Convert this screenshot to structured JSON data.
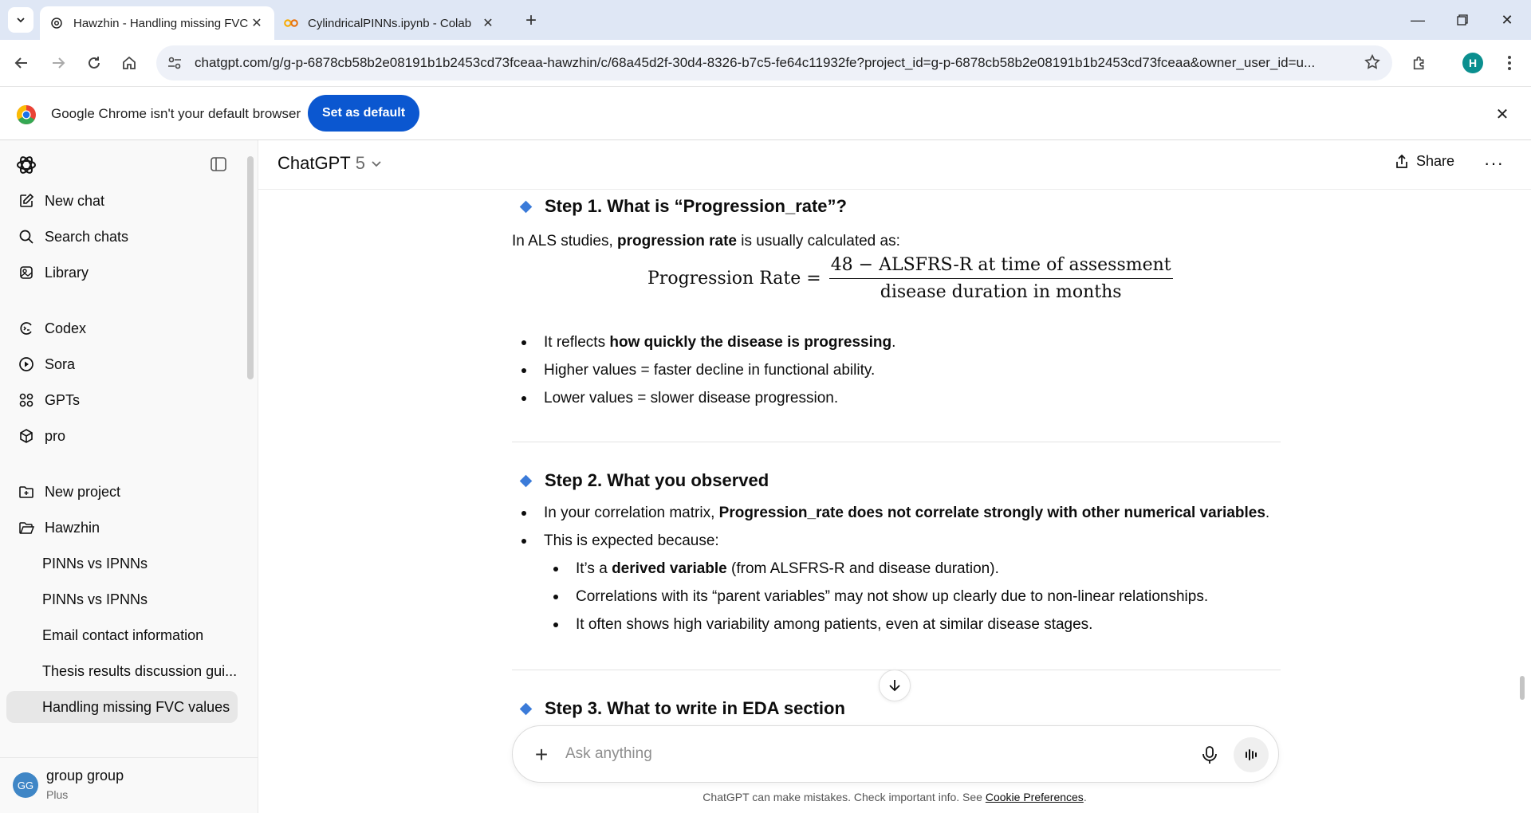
{
  "browser": {
    "tabs": [
      {
        "title": "Hawzhin - Handling missing FVC",
        "active": true,
        "icon": "chatgpt-icon"
      },
      {
        "title": "CylindricalPINNs.ipynb - Colab",
        "active": false,
        "icon": "colab-icon"
      }
    ],
    "url": "chatgpt.com/g/g-p-6878cb58b2e08191b1b2453cd73fceaa-hawzhin/c/68a45d2f-30d4-8326-b7c5-fe64c11932fe?project_id=g-p-6878cb58b2e08191b1b2453cd73fceaa&owner_user_id=u...",
    "profile_initial": "H",
    "infobar": {
      "message": "Google Chrome isn't your default browser",
      "button": "Set as default"
    }
  },
  "sidebar": {
    "top_items": [
      {
        "label": "New chat",
        "icon": "edit-icon"
      },
      {
        "label": "Search chats",
        "icon": "search-icon"
      },
      {
        "label": "Library",
        "icon": "library-icon"
      }
    ],
    "app_items": [
      {
        "label": "Codex",
        "icon": "codex-icon"
      },
      {
        "label": "Sora",
        "icon": "sora-icon"
      },
      {
        "label": "GPTs",
        "icon": "gpts-icon"
      },
      {
        "label": "pro",
        "icon": "cube-icon"
      }
    ],
    "project_items": [
      {
        "label": "New project",
        "icon": "new-folder-icon"
      },
      {
        "label": "Hawzhin",
        "icon": "folder-icon"
      }
    ],
    "chats": [
      {
        "label": "PINNs vs IPNNs",
        "selected": false
      },
      {
        "label": "PINNs vs IPNNs",
        "selected": false
      },
      {
        "label": "Email contact information",
        "selected": false
      },
      {
        "label": "Thesis results discussion gui...",
        "selected": false
      },
      {
        "label": "Handling missing FVC values",
        "selected": true
      }
    ],
    "user": {
      "initials": "GG",
      "name": "group group",
      "plan": "Plus"
    }
  },
  "header": {
    "model": "ChatGPT",
    "version": "5",
    "share": "Share"
  },
  "article": {
    "step1": {
      "title": "Step 1. What is “Progression_rate”?",
      "intro_pre": "In ALS studies, ",
      "intro_bold": "progression rate",
      "intro_post": " is usually calculated as:",
      "formula": {
        "lhs": "Progression Rate =",
        "numerator": "48 − ALSFRS-R at time of assessment",
        "denominator": "disease duration in months"
      },
      "b1_pre": "It reflects ",
      "b1_bold": "how quickly the disease is progressing",
      "b1_post": ".",
      "b2": "Higher values = faster decline in functional ability.",
      "b3": "Lower values = slower disease progression."
    },
    "step2": {
      "title": "Step 2. What you observed",
      "b1_pre": "In your correlation matrix, ",
      "b1_bold": "Progression_rate does not correlate strongly with other numerical variables",
      "b1_post": ".",
      "b2": "This is expected because:",
      "s1_pre": "It’s a ",
      "s1_bold": "derived variable",
      "s1_post": " (from ALSFRS-R and disease duration).",
      "s2": "Correlations with its “parent variables” may not show up clearly due to non-linear relationships.",
      "s3": "It often shows high variability among patients, even at similar disease stages."
    },
    "step3": {
      "title": "Step 3. What to write in EDA section"
    }
  },
  "composer": {
    "placeholder": "Ask anything"
  },
  "footer": {
    "text": "ChatGPT can make mistakes. Check important info. See ",
    "link": "Cookie Preferences",
    "end": "."
  },
  "colors": {
    "accent_blue": "#0b57d0",
    "bullet_diamond": "#3b7bd9",
    "tabbar_bg": "#dfe7f5"
  }
}
